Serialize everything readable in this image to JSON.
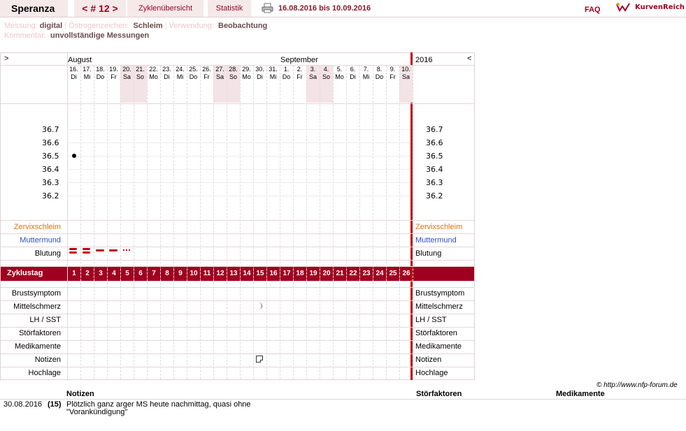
{
  "header": {
    "app_name": "Speranza",
    "cycle_nav": "< # 12 >",
    "zyklen_tab": "Zyklenübersicht",
    "statistik_tab": "Statistik",
    "date_range": "16.08.2016 bis 10.09.2016",
    "faq": "FAQ",
    "logo_text": "KurvenReich"
  },
  "meta": {
    "messung_label": "Messung:",
    "messung_value": "digital",
    "oestrogen_label": "Östrogenzeichen:",
    "oestrogen_value": "Schleim",
    "verwendung_label": "Verwendung:",
    "verwendung_value": "Beobachtung",
    "kommentar_label": "Kommentar:",
    "kommentar_value": "unvollständige Messungen"
  },
  "chart": {
    "nav_prev": ">",
    "nav_next": "<",
    "month1": "August",
    "month2": "September",
    "year": "2016",
    "days": [
      {
        "d": "16.",
        "w": "Di",
        "we": false
      },
      {
        "d": "17.",
        "w": "Mi",
        "we": false
      },
      {
        "d": "18.",
        "w": "Do",
        "we": false
      },
      {
        "d": "19.",
        "w": "Fr",
        "we": false
      },
      {
        "d": "20.",
        "w": "Sa",
        "we": true
      },
      {
        "d": "21.",
        "w": "So",
        "we": true
      },
      {
        "d": "22.",
        "w": "Mo",
        "we": false
      },
      {
        "d": "23.",
        "w": "Di",
        "we": false
      },
      {
        "d": "24.",
        "w": "Mi",
        "we": false
      },
      {
        "d": "25.",
        "w": "Do",
        "we": false
      },
      {
        "d": "26.",
        "w": "Fr",
        "we": false
      },
      {
        "d": "27.",
        "w": "Sa",
        "we": true
      },
      {
        "d": "28.",
        "w": "So",
        "we": true
      },
      {
        "d": "29.",
        "w": "Mo",
        "we": false
      },
      {
        "d": "30.",
        "w": "Di",
        "we": false
      },
      {
        "d": "31.",
        "w": "Mi",
        "we": false
      },
      {
        "d": "1.",
        "w": "Do",
        "we": false
      },
      {
        "d": "2.",
        "w": "Fr",
        "we": false
      },
      {
        "d": "3.",
        "w": "Sa",
        "we": true
      },
      {
        "d": "4.",
        "w": "So",
        "we": true
      },
      {
        "d": "5.",
        "w": "Mo",
        "we": false
      },
      {
        "d": "6.",
        "w": "Di",
        "we": false
      },
      {
        "d": "7.",
        "w": "Mi",
        "we": false
      },
      {
        "d": "8.",
        "w": "Do",
        "we": false
      },
      {
        "d": "9.",
        "w": "Fr",
        "we": false
      },
      {
        "d": "10.",
        "w": "Sa",
        "we": true
      }
    ],
    "temp_ticks": [
      "36.7",
      "36.6",
      "36.5",
      "36.4",
      "36.3",
      "36.2"
    ],
    "temperature_points": [
      {
        "day_index": 0,
        "value": 36.5
      }
    ],
    "rows_top": [
      "Zervixschleim",
      "Muttermund",
      "Blutung"
    ],
    "row_colors": {
      "Zervixschleim": "#e07010",
      "Muttermund": "#3050c0",
      "Blutung": "#000000"
    },
    "bleeding": [
      "heavy",
      "heavy",
      "medium",
      "medium",
      "spotting"
    ],
    "zyklustag_label": "Zyklustag",
    "cycle_days": [
      "1",
      "2",
      "3",
      "4",
      "5",
      "6",
      "7",
      "8",
      "9",
      "10",
      "11",
      "12",
      "13",
      "14",
      "15",
      "16",
      "17",
      "18",
      "19",
      "20",
      "21",
      "22",
      "23",
      "24",
      "25",
      "26"
    ],
    "rows_bottom": [
      "Brustsymptom",
      "Mittelschmerz",
      "LH / SST",
      "Störfaktoren",
      "Medikamente",
      "Notizen",
      "Hochlage"
    ],
    "mittelschmerz_day_index": 14,
    "notiz_day_index": 14,
    "accent": "#a00020"
  },
  "copyright": "© http://www.nfp-forum.de",
  "notes": {
    "col_notizen": "Notizen",
    "col_stoerfaktoren": "Störfaktoren",
    "col_medikamente": "Medikamente",
    "entry_date": "30.08.2016",
    "entry_day": "(15)",
    "entry_text_1": "Plötzlich ganz arger MS heute nachmittag, quasi ohne",
    "entry_text_2": "\"Vorankündigung\""
  }
}
